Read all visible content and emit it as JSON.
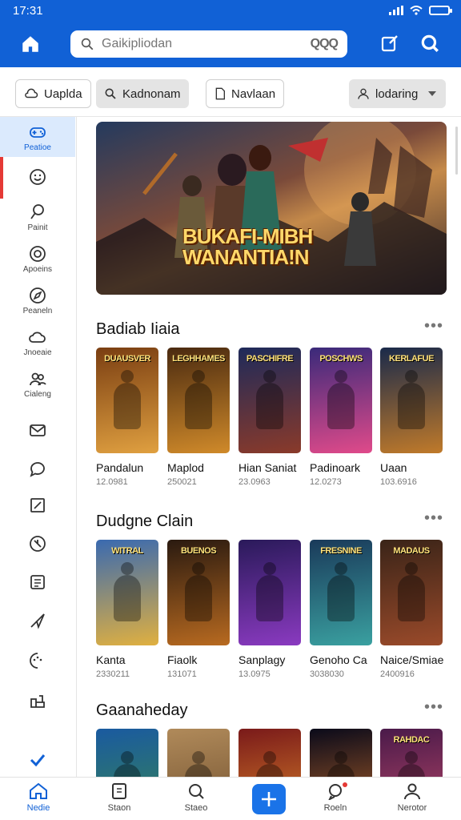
{
  "status": {
    "time": "17:31"
  },
  "search": {
    "placeholder": "Gaikipliodan",
    "trailing_text": "QQQ"
  },
  "filters": [
    {
      "label": "Uaplda",
      "icon": "cloud-icon"
    },
    {
      "label": "Kadnonam",
      "icon": "search-icon"
    },
    {
      "label": "Navlaan",
      "icon": "document-icon"
    },
    {
      "label": "lodaring",
      "icon": "user-icon",
      "dropdown": true
    }
  ],
  "sidebar": {
    "items": [
      {
        "label": "Peatioe",
        "icon": "gamepad-icon"
      },
      {
        "label": "",
        "icon": "smile-icon"
      },
      {
        "label": "Painit",
        "icon": "pin-icon"
      },
      {
        "label": "Apoeins",
        "icon": "circle-icon"
      },
      {
        "label": "Peaneln",
        "icon": "compass-icon"
      },
      {
        "label": "Jnoeaie",
        "icon": "cloud-icon"
      },
      {
        "label": "Cialeng",
        "icon": "group-icon"
      },
      {
        "label": "",
        "icon": "envelope-icon"
      },
      {
        "label": "",
        "icon": "chat-icon"
      },
      {
        "label": "",
        "icon": "edit-icon"
      },
      {
        "label": "",
        "icon": "clock-icon"
      },
      {
        "label": "",
        "icon": "list-icon"
      },
      {
        "label": "",
        "icon": "send-icon"
      },
      {
        "label": "",
        "icon": "palette-icon"
      },
      {
        "label": "",
        "icon": "grid-icon"
      },
      {
        "label": "",
        "icon": "check-icon"
      }
    ]
  },
  "hero": {
    "title_line1": "BUKAFI-MIBH",
    "title_line2": "WANANTIA!N"
  },
  "sections": [
    {
      "title": "Badiab Iiaia",
      "more": "•••",
      "cards": [
        {
          "name": "Pandalun",
          "meta": "12.0981",
          "poster_text": "DUAUSVER",
          "colors": [
            "#7a3e12",
            "#e0a040"
          ]
        },
        {
          "name": "Maplod",
          "meta": "250021",
          "poster_text": "LEGHHAMES",
          "colors": [
            "#4a2a10",
            "#d08a2a"
          ]
        },
        {
          "name": "Hian Saniat",
          "meta": "23.0963",
          "poster_text": "PASCHIFRE",
          "colors": [
            "#1e2a5a",
            "#8a3a2a"
          ]
        },
        {
          "name": "Padinoark",
          "meta": "12.0273",
          "poster_text": "POSCHWS",
          "colors": [
            "#3a2a7a",
            "#e04a8a"
          ]
        },
        {
          "name": "Uaan",
          "meta": "103.6916",
          "poster_text": "KERLAFUE",
          "colors": [
            "#1a2a4a",
            "#c07a2a"
          ]
        }
      ]
    },
    {
      "title": "Dudgne Clain",
      "more": "•••",
      "cards": [
        {
          "name": "Kanta",
          "meta": "2330211",
          "poster_text": "WITRAL",
          "colors": [
            "#3a6ab0",
            "#e0b040"
          ]
        },
        {
          "name": "Fiaolk",
          "meta": "131071",
          "poster_text": "BUENOS",
          "colors": [
            "#2a1a10",
            "#b86a20"
          ]
        },
        {
          "name": "Sanplagy",
          "meta": "13.0975",
          "poster_text": "",
          "colors": [
            "#2a1a5a",
            "#8a3ac0"
          ]
        },
        {
          "name": "Genoho Ca",
          "meta": "3038030",
          "poster_text": "FRESNINE",
          "colors": [
            "#1a3a5a",
            "#3aa0a0"
          ]
        },
        {
          "name": "Naice/Smiae",
          "meta": "2400916",
          "poster_text": "MADAUS",
          "colors": [
            "#3a2418",
            "#9a4a2a"
          ]
        }
      ]
    },
    {
      "title": "Gaanaheday",
      "more": "•••",
      "cards": [
        {
          "name": "",
          "meta": "",
          "poster_text": "",
          "colors": [
            "#1a5aa0",
            "#3a8a4a"
          ]
        },
        {
          "name": "",
          "meta": "",
          "poster_text": "",
          "colors": [
            "#b08a5a",
            "#6a4a2a"
          ]
        },
        {
          "name": "",
          "meta": "",
          "poster_text": "",
          "colors": [
            "#7a1a1a",
            "#e08a2a"
          ]
        },
        {
          "name": "",
          "meta": "",
          "poster_text": "",
          "colors": [
            "#0a0a1a",
            "#c06a2a"
          ]
        },
        {
          "name": "",
          "meta": "",
          "poster_text": "RAHDAC",
          "colors": [
            "#4a1a4a",
            "#c04a6a"
          ]
        }
      ]
    }
  ],
  "bottom_nav": [
    {
      "label": "Nedie",
      "icon": "home-icon",
      "active": true
    },
    {
      "label": "Staon",
      "icon": "book-icon"
    },
    {
      "label": "Staeo",
      "icon": "search-icon"
    },
    {
      "label": "",
      "icon": "plus-icon"
    },
    {
      "label": "Roeln",
      "icon": "bell-icon",
      "badge": true
    },
    {
      "label": "Nerotor",
      "icon": "profile-icon"
    }
  ],
  "colors": {
    "brand": "#1161d6",
    "accent": "#1a73e8",
    "indicator": "#e53935"
  }
}
